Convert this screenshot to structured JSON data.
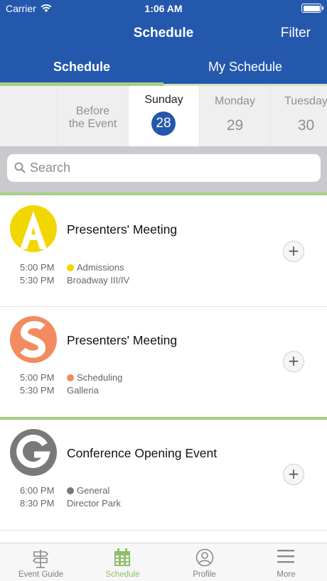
{
  "status_bar": {
    "carrier": "Carrier",
    "time": "1:06 AM",
    "battery_level": 1.0
  },
  "nav": {
    "title": "Schedule",
    "filter_label": "Filter"
  },
  "segments": {
    "schedule_label": "Schedule",
    "my_schedule_label": "My Schedule",
    "selected": "Schedule"
  },
  "days": {
    "before": {
      "label_line1": "Before",
      "label_line2": "the Event"
    },
    "sunday": {
      "name": "Sunday",
      "num": "28",
      "selected": true
    },
    "monday": {
      "name": "Monday",
      "num": "29"
    },
    "tuesday": {
      "name": "Tuesday",
      "num": "30"
    }
  },
  "search": {
    "placeholder": "Search",
    "value": ""
  },
  "sessions": [
    {
      "logo_letter": "A",
      "logo_color": "#f2d600",
      "title": "Presenters' Meeting",
      "start": "5:00 PM",
      "end": "5:30 PM",
      "track": "Admissions",
      "track_color": "#f2d600",
      "location": "Broadway III/IV"
    },
    {
      "logo_letter": "S",
      "logo_color": "#f28c60",
      "title": "Presenters' Meeting",
      "start": "5:00 PM",
      "end": "5:30 PM",
      "track": "Scheduling",
      "track_color": "#f28c60",
      "location": "Galleria"
    },
    {
      "logo_letter": "G",
      "logo_color": "#7b7878",
      "title": "Conference Opening Event",
      "start": "6:00 PM",
      "end": "8:30 PM",
      "track": "General",
      "track_color": "#7b7878",
      "location": "Director Park"
    }
  ],
  "tabbar": {
    "items": [
      {
        "label": "Event Guide",
        "icon": "signpost-icon"
      },
      {
        "label": "Schedule",
        "icon": "calendar-icon",
        "active": true
      },
      {
        "label": "Profile",
        "icon": "person-circle-icon"
      },
      {
        "label": "More",
        "icon": "menu-icon"
      }
    ]
  },
  "colors": {
    "brand": "#2458ad",
    "accent": "#a5cf87",
    "tab_active": "#8cc06a"
  }
}
